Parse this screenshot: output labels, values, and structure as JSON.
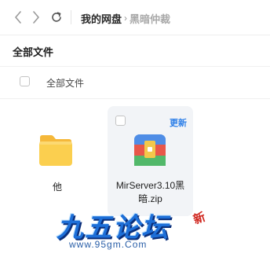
{
  "nav": {
    "back_icon": "chevron-left-icon",
    "forward_icon": "chevron-right-icon",
    "refresh_icon": "refresh-icon",
    "breadcrumb": {
      "root": "我的网盘",
      "separator": "›",
      "current": "黑暗仲裁"
    }
  },
  "section": {
    "title": "全部文件"
  },
  "select_all": {
    "label": "全部文件",
    "checked": false
  },
  "files": [
    {
      "name": "他",
      "type": "folder",
      "icon": "folder-icon"
    },
    {
      "name": "MirServer3.10黑暗.zip",
      "type": "zip",
      "icon": "zip-archive-icon",
      "badge": "更新",
      "selected": false
    }
  ],
  "watermark": {
    "title": "九五论坛",
    "seal": "新",
    "url": "www.95gm.Com"
  },
  "colors": {
    "accent": "#2d7fe8",
    "folder": "#f9c74a",
    "tile_background": "#f2f4f7",
    "watermark_blue": "#1d6fd8",
    "seal_red": "#d0271f"
  }
}
